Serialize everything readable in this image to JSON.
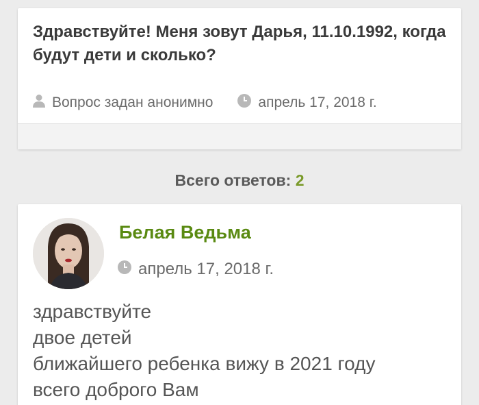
{
  "question": {
    "title": "Здравствуйте! Меня зовут Дарья, 11.10.1992, когда будут дети и сколько?",
    "author_text": "Вопрос задан анонимно",
    "author_icon": "user-icon",
    "date": "апрель 17, 2018 г.",
    "date_icon": "clock-icon"
  },
  "answers_summary": {
    "label": "Всего ответов:",
    "count": "2"
  },
  "answer": {
    "author": "Белая Ведьма",
    "date": "апрель 17, 2018 г.",
    "date_icon": "clock-icon",
    "lines": [
      "здравствуйте",
      "двое детей",
      "ближайшего ребенка вижу в 2021 году",
      "всего доброго Вам"
    ]
  },
  "colors": {
    "accent_green": "#5a8a12",
    "count_green": "#7a9a2a",
    "title_text": "#3a3a3a",
    "meta_text": "#6b6b6b",
    "background": "#ececec"
  }
}
